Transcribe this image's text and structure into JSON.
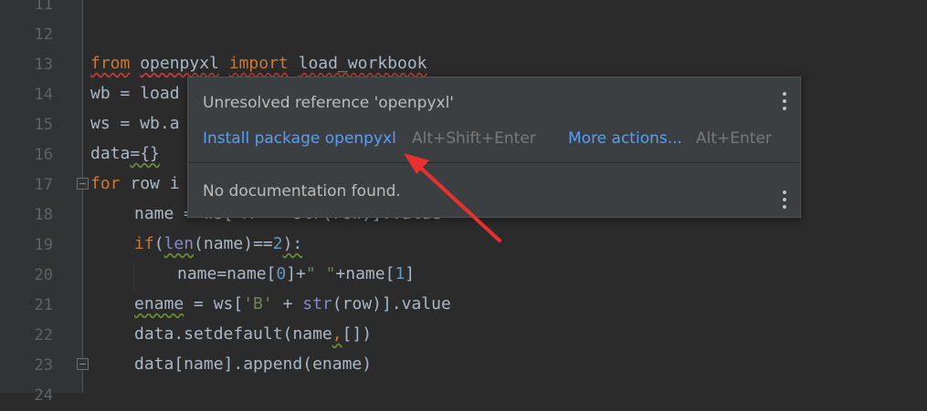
{
  "gutter": {
    "line_numbers": [
      "11",
      "12",
      "13",
      "14",
      "15",
      "16",
      "17",
      "18",
      "19",
      "20",
      "21",
      "22",
      "23",
      "24"
    ]
  },
  "code": {
    "line13": {
      "k1": "from",
      "mod": "openpyxl",
      "k2": "import",
      "fn": "load_workbook"
    },
    "line14": {
      "text": "wb = load"
    },
    "line15": {
      "text": "ws = wb.a"
    },
    "line16": {
      "var": "data",
      "rest": "={}"
    },
    "line17": {
      "k": "for",
      "rest": " row i"
    },
    "line18": {
      "text": "name = ws['A' + str(row)].value"
    },
    "line19": {
      "k": "if",
      "p1": "(",
      "fn": "len",
      "p2": "(name)==",
      "num": "2",
      "p3": "):"
    },
    "line20": {
      "a": "name=name[",
      "n0": "0",
      "b": "]+",
      "s": "\" \"",
      "c": "+name[",
      "n1": "1",
      "d": "]"
    },
    "line21": {
      "var": "ename",
      "a": " = ws[",
      "s": "'B'",
      "b": " + ",
      "fn": "str",
      "c": "(row)].value"
    },
    "line22": {
      "a": "data.setdefault(name",
      "comma": ",",
      "b": "[])"
    },
    "line23": {
      "text": "data[name].append(ename)"
    }
  },
  "popup": {
    "title": "Unresolved reference 'openpyxl'",
    "install_label": "Install package openpyxl",
    "install_shortcut": "Alt+Shift+Enter",
    "more_label": "More actions...",
    "more_shortcut": "Alt+Enter",
    "doc_text": "No documentation found."
  },
  "icons": {
    "menu_top": "more-vertical-icon",
    "menu_bottom": "more-vertical-icon",
    "annotation": "red-arrow-icon",
    "fold": "fold-icon"
  },
  "colors": {
    "background": "#2b2b2b",
    "keyword": "#cc7832",
    "string": "#6a8759",
    "number": "#6897bb",
    "builtin": "#8888c6",
    "link": "#589df6",
    "arrow": "#e8312f"
  }
}
